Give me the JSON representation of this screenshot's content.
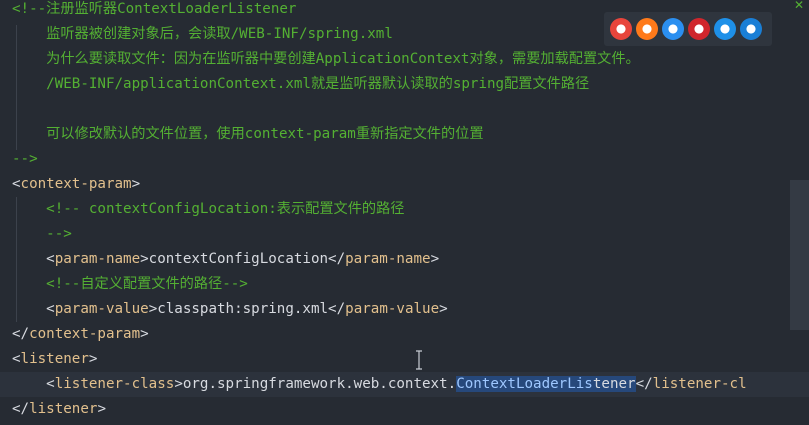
{
  "editor": {
    "lines": [
      {
        "segments": [
          {
            "text": "<!--注册监听器ContextLoaderListener",
            "cls": "c"
          }
        ]
      },
      {
        "segments": [
          {
            "text": "    监听器被创建对象后，会读取/WEB-INF/spring.xml",
            "cls": "c"
          }
        ]
      },
      {
        "segments": [
          {
            "text": "    为什么要读取文件：因为在监听器中要创建ApplicationContext对象，需要加载配置文件。",
            "cls": "c"
          }
        ]
      },
      {
        "segments": [
          {
            "text": "    /WEB-INF/applicationContext.xml就是监听器默认读取的spring配置文件路径",
            "cls": "c"
          }
        ]
      },
      {
        "segments": []
      },
      {
        "segments": [
          {
            "text": "    可以修改默认的文件位置，使用context-param重新指定文件的位置",
            "cls": "c"
          }
        ]
      },
      {
        "segments": [
          {
            "text": "-->",
            "cls": "c"
          }
        ]
      },
      {
        "segments": [
          {
            "text": "<",
            "cls": "x"
          },
          {
            "text": "context-param",
            "cls": "t"
          },
          {
            "text": ">",
            "cls": "x"
          }
        ]
      },
      {
        "segments": [
          {
            "text": "    <!-- contextConfigLocation:表示配置文件的路径",
            "cls": "c"
          }
        ]
      },
      {
        "segments": [
          {
            "text": "    -->",
            "cls": "c"
          }
        ]
      },
      {
        "segments": [
          {
            "text": "    <",
            "cls": "x"
          },
          {
            "text": "param-name",
            "cls": "t"
          },
          {
            "text": ">contextConfigLocation</",
            "cls": "x"
          },
          {
            "text": "param-name",
            "cls": "t"
          },
          {
            "text": ">",
            "cls": "x"
          }
        ]
      },
      {
        "segments": [
          {
            "text": "    <!--自定义配置文件的路径-->",
            "cls": "c"
          }
        ]
      },
      {
        "segments": [
          {
            "text": "    <",
            "cls": "x"
          },
          {
            "text": "param-value",
            "cls": "t"
          },
          {
            "text": ">classpath:spring.xml</",
            "cls": "x"
          },
          {
            "text": "param-value",
            "cls": "t"
          },
          {
            "text": ">",
            "cls": "x"
          }
        ]
      },
      {
        "segments": [
          {
            "text": "</",
            "cls": "x"
          },
          {
            "text": "context-param",
            "cls": "t"
          },
          {
            "text": ">",
            "cls": "x"
          }
        ]
      },
      {
        "segments": [
          {
            "text": "<",
            "cls": "x"
          },
          {
            "text": "listener",
            "cls": "t"
          },
          {
            "text": ">",
            "cls": "x"
          }
        ]
      },
      {
        "current": true,
        "segments": [
          {
            "text": "    <",
            "cls": "x"
          },
          {
            "text": "listener-class",
            "cls": "t"
          },
          {
            "text": ">org.springframework.web.context.",
            "cls": "x"
          },
          {
            "text": "ContextLoaderLis",
            "cls": "sel"
          },
          {
            "text": "tener",
            "cls": "sel-end"
          },
          {
            "text": "</",
            "cls": "x"
          },
          {
            "text": "listener-cl",
            "cls": "t"
          }
        ]
      },
      {
        "segments": [
          {
            "text": "</",
            "cls": "x"
          },
          {
            "text": "listener",
            "cls": "t"
          },
          {
            "text": ">",
            "cls": "x"
          }
        ]
      }
    ]
  },
  "browsers": [
    {
      "name": "chrome-icon",
      "color": "#e8453c"
    },
    {
      "name": "firefox-icon",
      "color": "#ff7a1a"
    },
    {
      "name": "safari-icon",
      "color": "#2b8ff0"
    },
    {
      "name": "opera-icon",
      "color": "#d0262c"
    },
    {
      "name": "ie-icon",
      "color": "#1e90e8"
    },
    {
      "name": "edge-icon",
      "color": "#1a7fd6"
    }
  ],
  "fold_marker": "✕"
}
